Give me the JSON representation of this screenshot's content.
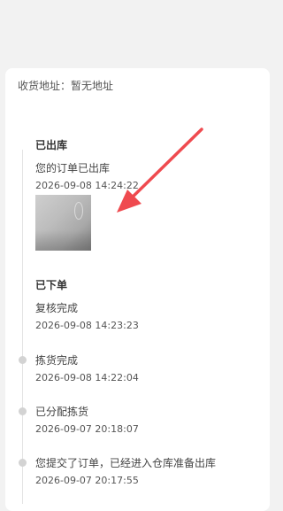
{
  "address": {
    "label": "收货地址：暂无地址"
  },
  "timeline": [
    {
      "title": "已出库",
      "desc": "您的订单已出库",
      "time": "2026-09-08 14:24:22"
    },
    {
      "title": "已下单",
      "desc": "复核完成",
      "time": "2026-09-08 14:23:23"
    },
    {
      "desc": "拣货完成",
      "time": "2026-09-08 14:22:04"
    },
    {
      "desc": "已分配拣货",
      "time": "2026-09-07 20:18:07"
    },
    {
      "desc": "您提交了订单，已经进入仓库准备出库",
      "time": "2026-09-07 20:17:55"
    }
  ],
  "colors": {
    "arrow": "#ef4a4f",
    "dot": "#d3d3d3",
    "line": "#e3e3e3"
  },
  "icons": {
    "arrow": "red-arrow-icon"
  }
}
